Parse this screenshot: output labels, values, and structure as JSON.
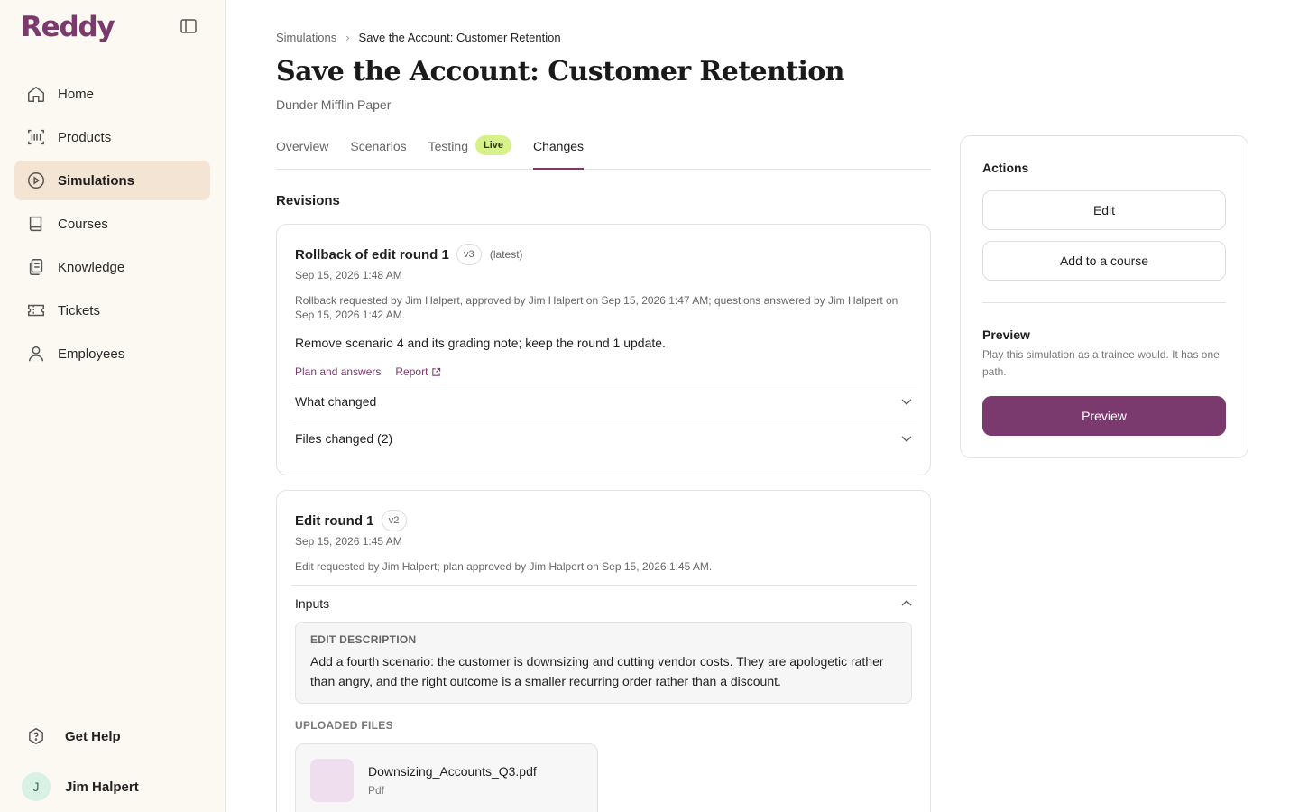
{
  "app": {
    "logo": "Reddy"
  },
  "sidebar": {
    "items": [
      {
        "label": "Home",
        "icon": "home-icon"
      },
      {
        "label": "Products",
        "icon": "barcode-icon"
      },
      {
        "label": "Simulations",
        "icon": "play-circle-icon",
        "active": true
      },
      {
        "label": "Courses",
        "icon": "book-icon"
      },
      {
        "label": "Knowledge",
        "icon": "documents-icon"
      },
      {
        "label": "Tickets",
        "icon": "ticket-icon"
      },
      {
        "label": "Employees",
        "icon": "user-icon"
      }
    ],
    "help_label": "Get Help",
    "user": {
      "initial": "J",
      "name": "Jim Halpert"
    }
  },
  "breadcrumb": {
    "parent": "Simulations",
    "current": "Save the Account: Customer Retention"
  },
  "page": {
    "title": "Save the Account: Customer Retention",
    "subtitle": "Dunder Mifflin Paper"
  },
  "tabs": [
    {
      "label": "Overview"
    },
    {
      "label": "Scenarios"
    },
    {
      "label": "Testing",
      "badge": "Live"
    },
    {
      "label": "Changes",
      "active": true
    }
  ],
  "revisions": {
    "title": "Revisions",
    "items": [
      {
        "name": "Rollback of edit round 1",
        "version": "v3",
        "tag": "(latest)",
        "date": "Sep 15, 2026 1:48 AM",
        "description": "Rollback requested by Jim Halpert, approved by Jim Halpert on Sep 15, 2026 1:47 AM; questions answered by Jim Halpert on Sep 15, 2026 1:42 AM.",
        "summary": "Remove scenario 4 and its grading note; keep the round 1 update.",
        "links": {
          "plan": "Plan and answers",
          "report": "Report"
        },
        "sections": [
          "What changed",
          "Files changed (2)"
        ]
      },
      {
        "name": "Edit round 1",
        "version": "v2",
        "date": "Sep 15, 2026 1:45 AM",
        "description": "Edit requested by Jim Halpert; plan approved by Jim Halpert on Sep 15, 2026 1:45 AM.",
        "inputs_label": "Inputs",
        "edit_description_label": "EDIT DESCRIPTION",
        "edit_description": "Add a fourth scenario: the customer is downsizing and cutting vendor costs. They are apologetic rather than angry, and the right outcome is a smaller recurring order rather than a discount.",
        "uploaded_files_label": "UPLOADED FILES",
        "files": [
          {
            "name": "Downsizing_Accounts_Q3.pdf",
            "type": "Pdf"
          }
        ]
      }
    ]
  },
  "actions": {
    "title": "Actions",
    "edit_label": "Edit",
    "add_course_label": "Add to a course",
    "preview_title": "Preview",
    "preview_desc": "Play this simulation as a trainee would. It has one path.",
    "preview_button": "Preview"
  },
  "colors": {
    "brand": "#7a3a6e",
    "sidebar_bg": "#fcf8f2",
    "active_nav": "#f4e4d4",
    "live_badge": "#d7f28a"
  }
}
